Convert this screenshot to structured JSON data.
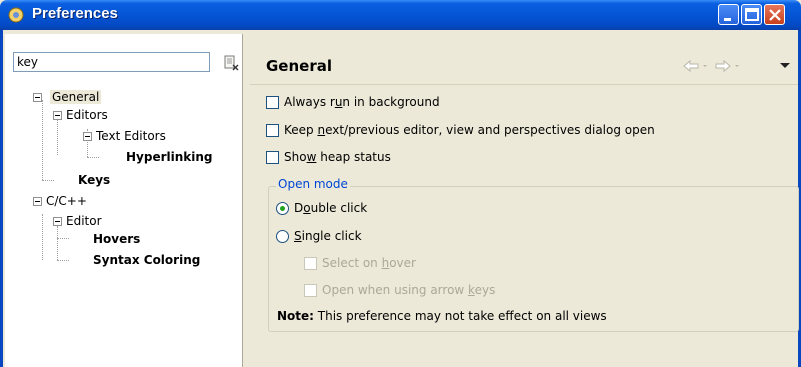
{
  "window": {
    "title": "Preferences",
    "controls": [
      "minimize",
      "maximize",
      "close"
    ]
  },
  "filter": {
    "value": "key"
  },
  "tree": {
    "general": "General",
    "editors": "Editors",
    "text_editors": "Text Editors",
    "hyperlinking": "Hyperlinking",
    "keys": "Keys",
    "cpp": "C/C++",
    "editor": "Editor",
    "hovers": "Hovers",
    "syntax_coloring": "Syntax Coloring"
  },
  "page": {
    "title": "General",
    "options": {
      "always_run_bg": {
        "prefix": "Always r",
        "mnemonic": "u",
        "suffix": "n in background",
        "checked": false
      },
      "keep_next": {
        "prefix": "Keep ",
        "mnemonic": "n",
        "suffix": "ext/previous editor, view and perspectives dialog open",
        "checked": false
      },
      "show_heap": {
        "prefix": "Sho",
        "mnemonic": "w",
        "suffix": " heap status",
        "checked": false
      }
    },
    "open_mode": {
      "legend": "Open mode",
      "double_click": {
        "prefix": "D",
        "mnemonic": "o",
        "suffix": "uble click",
        "selected": true
      },
      "single_click": {
        "prefix": "",
        "mnemonic": "S",
        "suffix": "ingle click",
        "selected": false
      },
      "select_on_hover": {
        "prefix": "Select on ",
        "mnemonic": "h",
        "suffix": "over",
        "enabled": false
      },
      "open_arrow_keys": {
        "prefix": "Open when using arrow ",
        "mnemonic": "k",
        "suffix": "eys",
        "enabled": false
      },
      "note_label": "Note:",
      "note_text": " This preference may not take effect on all views"
    }
  },
  "nav": {
    "back_icon": "back-arrow-icon",
    "forward_icon": "forward-arrow-icon",
    "menu_icon": "view-menu-icon"
  }
}
